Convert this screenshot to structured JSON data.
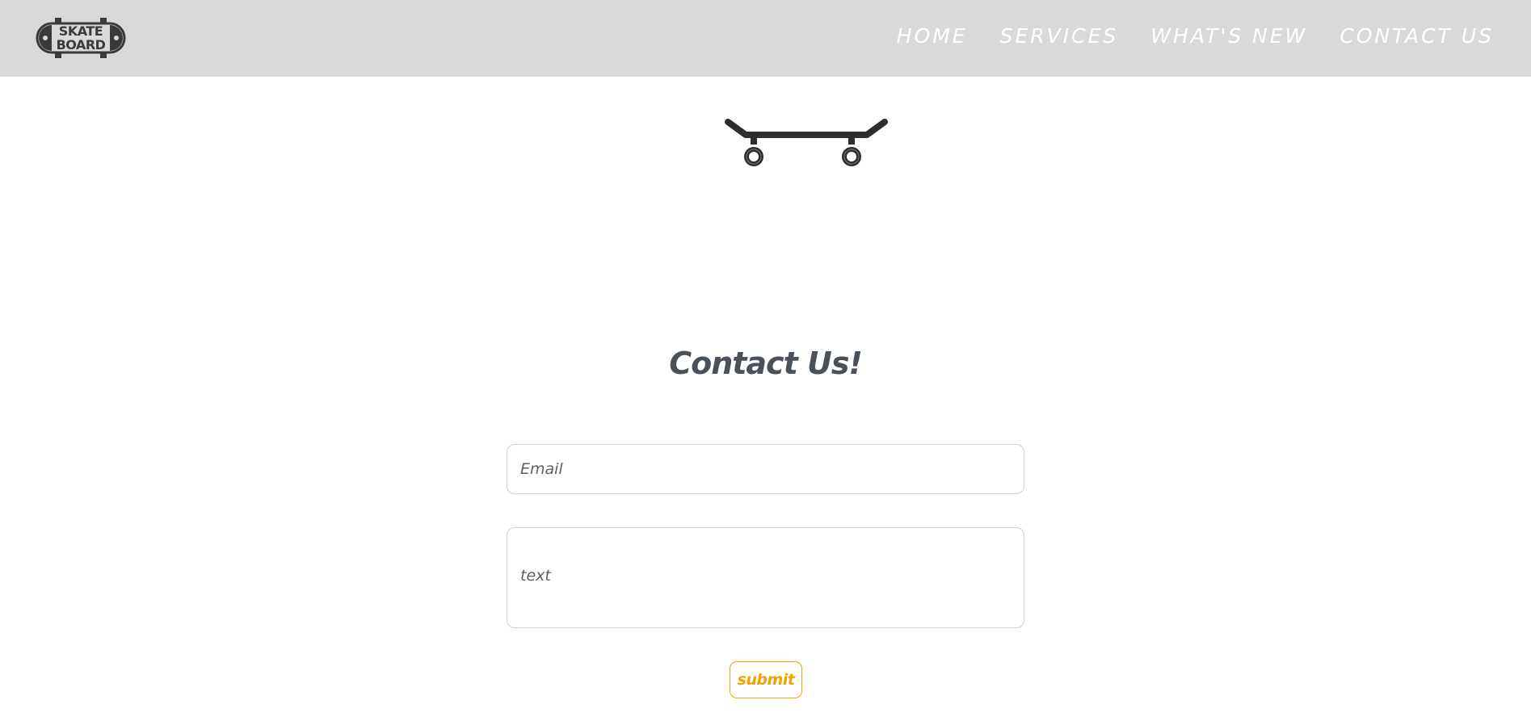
{
  "header": {
    "logo_text_line1": "SKATE",
    "logo_text_line2": "BOARD",
    "logo_icon": "skateboard-logo-icon",
    "background_color": "#d9d9d9",
    "nav": [
      {
        "label": "HOME"
      },
      {
        "label": "SERVICES"
      },
      {
        "label": "WHAT'S NEW"
      },
      {
        "label": "CONTACT US"
      }
    ]
  },
  "hero": {
    "icon": "skateboard-icon"
  },
  "contact": {
    "title": "Contact Us!",
    "email_placeholder": "Email",
    "text_placeholder": "text",
    "submit_label": "submit",
    "accent_color": "#f2a300",
    "title_color": "#4b5158"
  }
}
